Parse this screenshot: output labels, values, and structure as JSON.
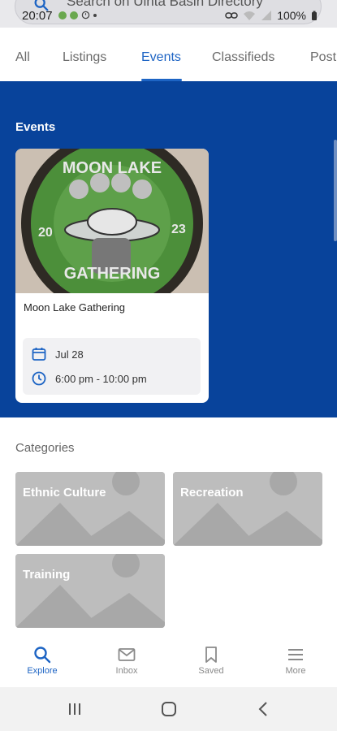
{
  "status_bar": {
    "time": "20:07",
    "battery": "100%"
  },
  "search": {
    "placeholder": "Search on Uinta Basin Directory"
  },
  "tabs": [
    {
      "label": "All"
    },
    {
      "label": "Listings"
    },
    {
      "label": "Events"
    },
    {
      "label": "Classifieds"
    },
    {
      "label": "Post"
    }
  ],
  "active_tab": "Events",
  "events": {
    "title": "Events",
    "cards": [
      {
        "name": "Moon Lake Gathering",
        "date": "Jul 28",
        "time": "6:00 pm - 10:00 pm",
        "image_text": {
          "top": "MOON LAKE",
          "year_left": "20",
          "year_right": "23",
          "bottom": "GATHERING"
        }
      }
    ]
  },
  "categories": {
    "title": "Categories",
    "items": [
      {
        "label": "Ethnic Culture"
      },
      {
        "label": "Recreation"
      },
      {
        "label": "Training"
      }
    ]
  },
  "bottom_nav": [
    {
      "label": "Explore",
      "icon": "search-icon"
    },
    {
      "label": "Inbox",
      "icon": "mail-icon"
    },
    {
      "label": "Saved",
      "icon": "bookmark-icon"
    },
    {
      "label": "More",
      "icon": "menu-icon"
    }
  ],
  "colors": {
    "accent": "#1d64c4",
    "events_band": "#08439b",
    "tile_gray": "#bdbdbd"
  }
}
